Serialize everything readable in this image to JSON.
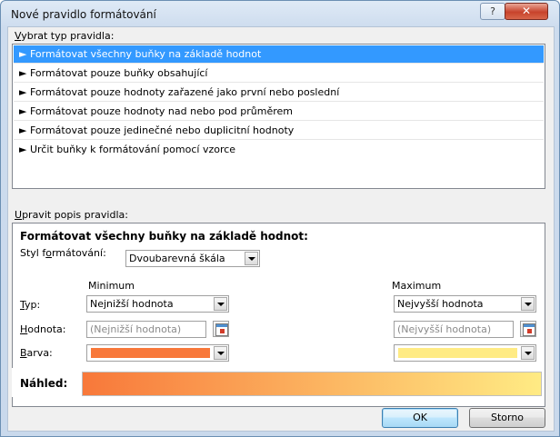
{
  "window": {
    "title": "Nové pravidlo formátování",
    "help_glyph": "?",
    "close_glyph": "✕"
  },
  "rule_type": {
    "label_key": "V",
    "label_rest": "ybrat typ pravidla:",
    "items": [
      "► Formátovat všechny buňky na základě hodnot",
      "► Formátovat pouze buňky obsahující",
      "► Formátovat pouze hodnoty zařazené jako první nebo poslední",
      "► Formátovat pouze hodnoty nad nebo pod průměrem",
      "► Formátovat pouze jedinečné nebo duplicitní hodnoty",
      "► Určit buňky k formátování pomocí vzorce"
    ],
    "selected_index": 0
  },
  "description": {
    "label_key": "U",
    "label_rest": "pravit popis pravidla:",
    "heading": "Formátovat všechny buňky na základě hodnot:",
    "style_label_a": "Styl f",
    "style_label_key": "o",
    "style_label_b": "rmátování:",
    "style_value": "Dvoubarevná škála",
    "minimum_header": "Minimum",
    "maximum_header": "Maximum",
    "type_label_key": "T",
    "type_label_rest": "yp:",
    "value_label_key": "H",
    "value_label_rest": "odnota:",
    "color_label_key": "B",
    "color_label_rest": "arva:",
    "min_type": "Nejnižší hodnota",
    "max_type": "Nejvyšší hodnota",
    "min_value_placeholder": "(Nejnižší hodnota)",
    "max_value_placeholder": "(Nejvyšší hodnota)",
    "min_color": "#f8783a",
    "max_color": "#ffeb84",
    "preview_label": "Náhled:"
  },
  "buttons": {
    "ok": "OK",
    "cancel": "Storno"
  }
}
